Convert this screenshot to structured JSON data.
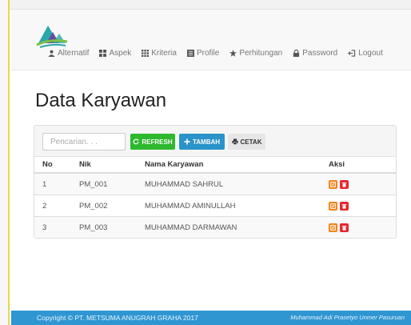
{
  "nav": {
    "items": [
      {
        "label": "Alternatif",
        "icon": "user-icon"
      },
      {
        "label": "Aspek",
        "icon": "th-large-icon"
      },
      {
        "label": "Kriteria",
        "icon": "th-icon"
      },
      {
        "label": "Profile",
        "icon": "list-alt-icon"
      },
      {
        "label": "Perhitungan",
        "icon": "star-icon"
      },
      {
        "label": "Password",
        "icon": "lock-icon"
      },
      {
        "label": "Logout",
        "icon": "logout-icon"
      }
    ]
  },
  "page": {
    "title": "Data Karyawan"
  },
  "toolbar": {
    "search_placeholder": "Pencarian. . .",
    "refresh_label": "REFRESH",
    "tambah_label": "TAMBAH",
    "cetak_label": "CETAK"
  },
  "table": {
    "headers": [
      "No",
      "Nik",
      "Nama Karyawan",
      "Aksi"
    ],
    "rows": [
      {
        "no": "1",
        "nik": "PM_001",
        "nama": "MUHAMMAD SAHRUL"
      },
      {
        "no": "2",
        "nik": "PM_002",
        "nama": "MUHAMMAD AMINULLAH"
      },
      {
        "no": "3",
        "nik": "PM_003",
        "nama": "MUHAMMAD DARMAWAN"
      }
    ],
    "actions": {
      "edit_icon": "edit-icon",
      "delete_icon": "trash-icon"
    }
  },
  "footer": {
    "copyright": "Copyright © PT. METSUMA ANUGRAH GRAHA 2017",
    "credit": "Muhammad Adi Prasetyo Unmer Pasuruan"
  },
  "colors": {
    "refresh": "#2eb82e",
    "tambah": "#2a93c9",
    "edit": "#f0861d",
    "delete": "#e8262c",
    "footer": "#2f96d2",
    "logo_teal": "#2aa7a8",
    "logo_green": "#7bc043",
    "logo_purple": "#6b4a9b"
  }
}
